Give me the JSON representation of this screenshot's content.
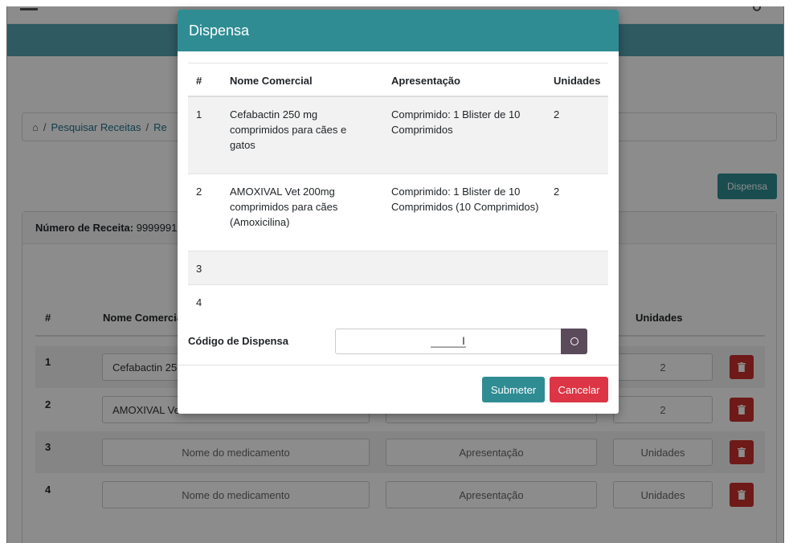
{
  "background": {
    "breadcrumb": {
      "home_icon": "home-icon",
      "separator": "/",
      "link1": "Pesquisar Receitas",
      "link2_partial": "Re"
    },
    "dispensa_button": "Dispensa",
    "card": {
      "recipe_label": "Número de Receita:",
      "recipe_value": "9999991"
    },
    "table": {
      "headers": [
        "#",
        "Nome Comercial",
        "Apresentação",
        "Unidades"
      ],
      "rows": [
        {
          "num": "1",
          "nome": "Cefabactin 25",
          "apresentacao": "",
          "unidades": "2"
        },
        {
          "num": "2",
          "nome": "AMOXIVAL Ve",
          "apresentacao": "",
          "unidades": "2"
        },
        {
          "num": "3",
          "nome_placeholder": "Nome do medicamento",
          "apresentacao_placeholder": "Apresentação",
          "unidades_placeholder": "Unidades"
        },
        {
          "num": "4",
          "nome_placeholder": "Nome do medicamento",
          "apresentacao_placeholder": "Apresentação",
          "unidades_placeholder": "Unidades"
        }
      ],
      "row_action_icon": "trash-icon"
    }
  },
  "modal": {
    "title": "Dispensa",
    "table": {
      "headers": [
        "#",
        "Nome Comercial",
        "Apresentação",
        "Unidades"
      ],
      "rows": [
        {
          "num": "1",
          "nome": "Cefabactin 250 mg comprimidos para cães e gatos",
          "apresentacao": "Comprimido: 1 Blister de 10 Comprimidos",
          "unidades": "2"
        },
        {
          "num": "2",
          "nome": "AMOXIVAL Vet 200mg comprimidos para cães (Amoxicilina)",
          "apresentacao": "Comprimido: 1 Blister de 10 Comprimidos (10 Comprimidos)",
          "unidades": "2"
        },
        {
          "num": "3",
          "nome": "",
          "apresentacao": "",
          "unidades": ""
        },
        {
          "num": "4",
          "nome": "",
          "apresentacao": "",
          "unidades": ""
        }
      ]
    },
    "code_label": "Código de Dispensa",
    "code_value": "______",
    "code_button_icon": "circle-icon",
    "submit_label": "Submeter",
    "cancel_label": "Cancelar"
  },
  "colors": {
    "primary": "#2f8c93",
    "danger": "#dc3545",
    "banner": "#56a5b1"
  }
}
